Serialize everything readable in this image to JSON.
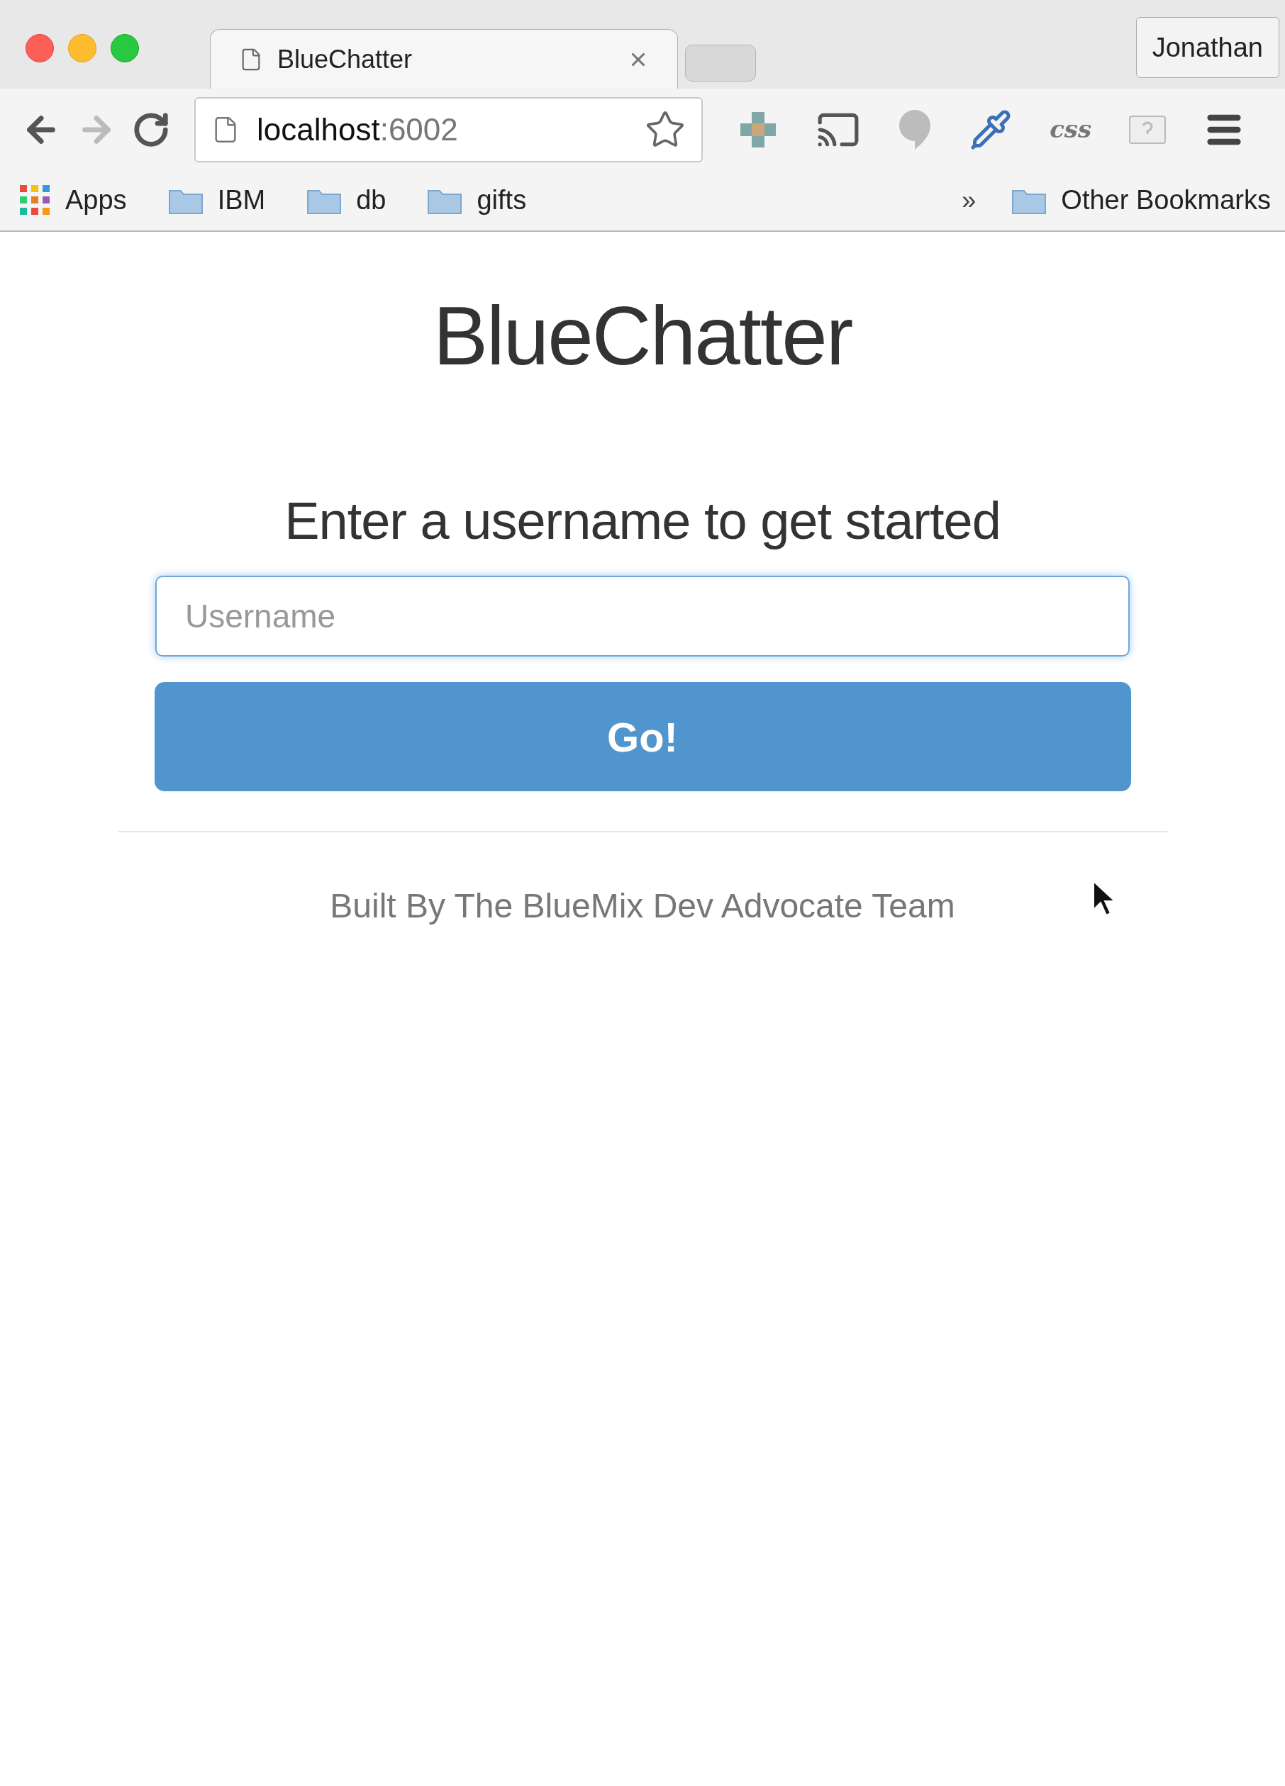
{
  "browser": {
    "tabs": [
      {
        "title": "BlueChatter",
        "selected": true
      }
    ],
    "profile": "Jonathan",
    "address": {
      "host": "localhost",
      "port": ":6002"
    },
    "bookmarks": [
      {
        "label": "Apps",
        "kind": "apps"
      },
      {
        "label": "IBM",
        "kind": "folder"
      },
      {
        "label": "db",
        "kind": "folder"
      },
      {
        "label": "gifts",
        "kind": "folder"
      }
    ],
    "overflow": "»",
    "other_bookmarks": "Other Bookmarks",
    "css_label": "css"
  },
  "page": {
    "title": "BlueChatter",
    "prompt": "Enter a username to get started",
    "username": {
      "placeholder": "Username"
    },
    "submit": "Go!",
    "footer": "Built By The BlueMix Dev Advocate Team"
  }
}
